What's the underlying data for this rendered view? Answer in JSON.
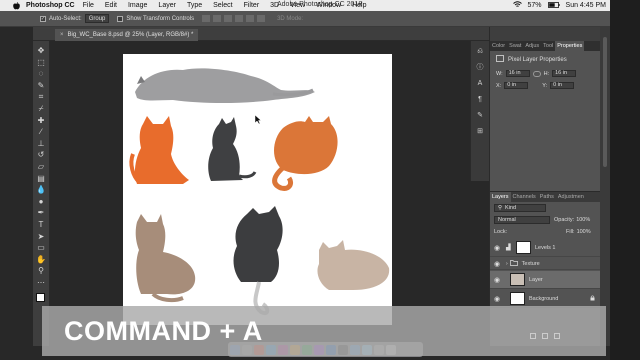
{
  "menubar": {
    "app_name": "Photoshop CC",
    "items": [
      "File",
      "Edit",
      "Image",
      "Layer",
      "Type",
      "Select",
      "Filter",
      "3D",
      "View",
      "Window",
      "Help"
    ],
    "window_title": "Adobe Photoshop CC 2018",
    "battery": "57%",
    "clock": "Sun 4:45 PM"
  },
  "options": {
    "auto_select_label": "Auto-Select:",
    "auto_select_value": "Group",
    "transform_controls_label": "Show Transform Controls",
    "mode_3d_label": "3D Mode:"
  },
  "document": {
    "tab_title": "Big_WC_Base 8.psd @ 25% (Layer, RGB/8#) *",
    "close_glyph": "×"
  },
  "panel_tabs": [
    "Color",
    "Swat",
    "Adjus",
    "Tool",
    "Properties"
  ],
  "properties": {
    "title": "Pixel Layer Properties",
    "w_label": "W:",
    "w_value": "16 in",
    "h_label": "H:",
    "h_value": "16 in",
    "x_label": "X:",
    "x_value": "0 in",
    "y_label": "Y:",
    "y_value": "0 in"
  },
  "layers_panel": {
    "tabs": [
      "Layers",
      "Channels",
      "Paths",
      "Adjustmen"
    ],
    "filter": "Kind",
    "blend_mode": "Normal",
    "opacity_label": "Opacity:",
    "opacity_value": "100%",
    "lock_label": "Lock:",
    "fill_label": "Fill:",
    "fill_value": "100%",
    "layers": [
      {
        "name": "Levels 1"
      },
      {
        "name": "Texture"
      },
      {
        "name": "Layer"
      },
      {
        "name": "Background"
      }
    ]
  },
  "caption": {
    "text": "COMMAND + A"
  },
  "icons": {
    "apple": "apple-icon",
    "eye": "eye-icon",
    "folder": "folder-icon"
  }
}
